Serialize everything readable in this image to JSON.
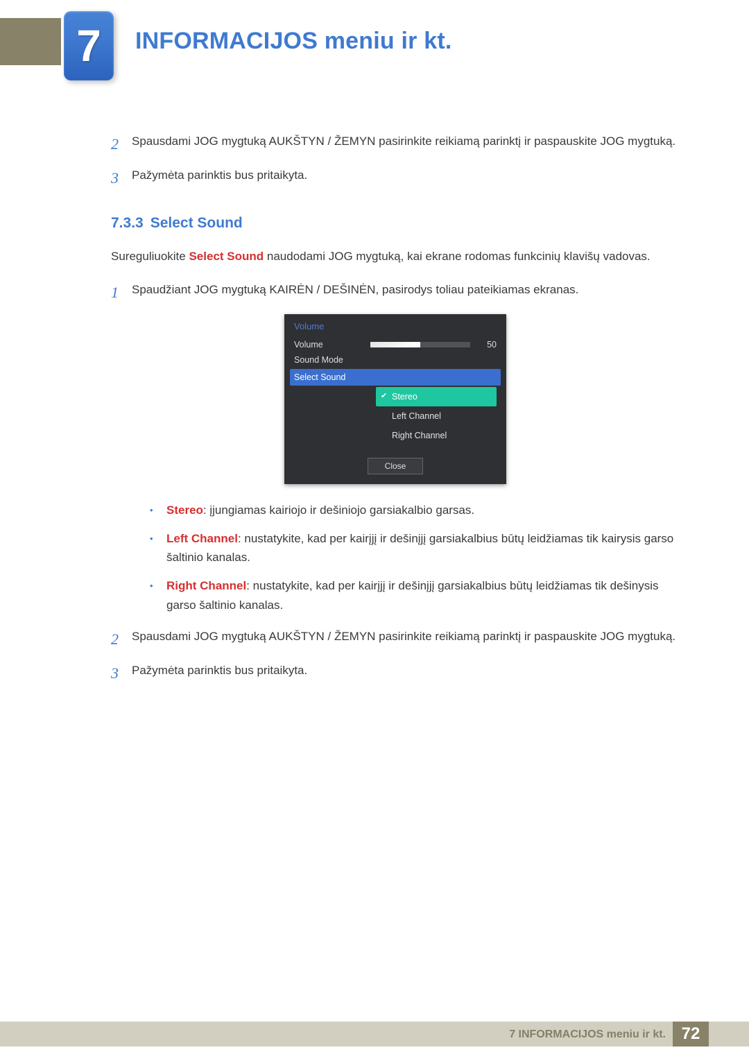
{
  "chapter": {
    "number": "7",
    "title": "INFORMACIJOS meniu ir kt."
  },
  "steps_top": [
    {
      "n": "2",
      "text": "Spausdami JOG mygtuką AUKŠTYN / ŽEMYN pasirinkite reikiamą parinktį ir paspauskite JOG mygtuką."
    },
    {
      "n": "3",
      "text": "Pažymėta parinktis bus pritaikyta."
    }
  ],
  "section": {
    "num": "7.3.3",
    "title": "Select Sound"
  },
  "intro": {
    "pre": "Sureguliuokite ",
    "kw": "Select Sound",
    "post": " naudodami JOG mygtuką, kai ekrane rodomas funkcinių klavišų vadovas."
  },
  "step_mid": {
    "n": "1",
    "text": "Spaudžiant JOG mygtuką KAIRĖN / DEŠINĖN, pasirodys toliau pateikiamas ekranas."
  },
  "osd": {
    "title": "Volume",
    "rows": {
      "volume": {
        "label": "Volume",
        "value": "50"
      },
      "soundmode": {
        "label": "Sound Mode"
      },
      "selectsound": {
        "label": "Select Sound"
      }
    },
    "options": [
      {
        "label": "Stereo",
        "active": true
      },
      {
        "label": "Left Channel",
        "active": false
      },
      {
        "label": "Right Channel",
        "active": false
      }
    ],
    "close": "Close"
  },
  "bullets": [
    {
      "kw": "Stereo",
      "text": ": įjungiamas kairiojo ir dešiniojo garsiakalbio garsas."
    },
    {
      "kw": "Left Channel",
      "text": ": nustatykite, kad per kairįjį ir dešinįjį garsiakalbius būtų leidžiamas tik kairysis garso šaltinio kanalas."
    },
    {
      "kw": "Right Channel",
      "text": ": nustatykite, kad per kairįjį ir dešinįjį garsiakalbius būtų leidžiamas tik dešinysis garso šaltinio kanalas."
    }
  ],
  "steps_bottom": [
    {
      "n": "2",
      "text": "Spausdami JOG mygtuką AUKŠTYN / ŽEMYN pasirinkite reikiamą parinktį ir paspauskite JOG mygtuką."
    },
    {
      "n": "3",
      "text": "Pažymėta parinktis bus pritaikyta."
    }
  ],
  "footer": {
    "chapter": "7 INFORMACIJOS meniu ir kt.",
    "page": "72"
  }
}
